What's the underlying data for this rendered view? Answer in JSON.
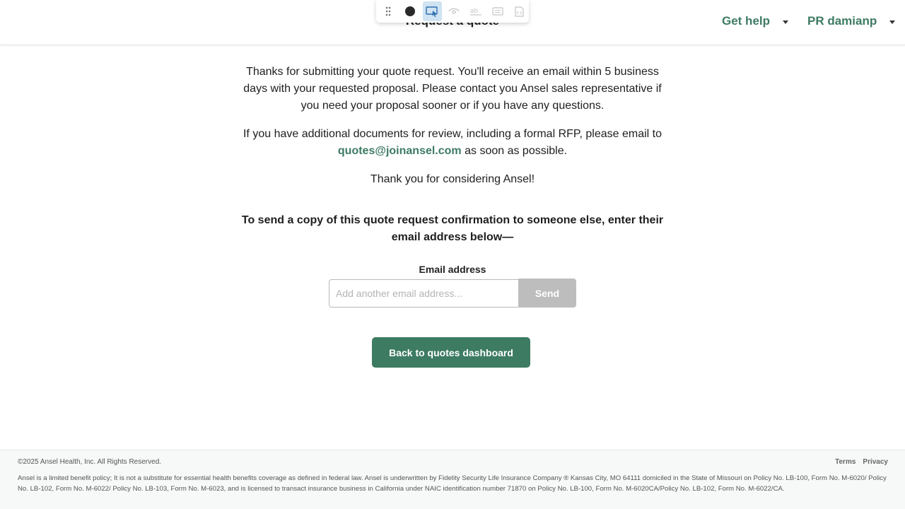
{
  "header": {
    "title": "Request a quote",
    "help_menu": "Get help",
    "user_menu": "PR damianp"
  },
  "toolbar": {
    "tools": [
      "drag-handle-icon",
      "record-icon",
      "select-element-icon",
      "eye-icon",
      "text-style-icon",
      "text-block-icon",
      "code-file-icon"
    ],
    "active_tool": "select-element-icon"
  },
  "confirmation": {
    "para1": "Thanks for submitting your quote request. You'll receive an email within 5 business days with your requested proposal. Please contact you Ansel sales representative if you need your proposal sooner or if you have any questions.",
    "para2_before": "If you have additional documents for review, including a formal RFP, please email to ",
    "email_link": "quotes@joinansel.com",
    "para2_after": " as soon as possible.",
    "para3": "Thank you for considering Ansel!"
  },
  "send_copy": {
    "heading": "To send a copy of this quote request confirmation to someone else, enter their email address below—",
    "label": "Email address",
    "placeholder": "Add another email address...",
    "value": "",
    "send_label": "Send"
  },
  "back_button": "Back to quotes dashboard",
  "footer": {
    "copyright": "©2025 Ansel Health, Inc. All Rights Reserved.",
    "links": [
      "Terms",
      "Privacy"
    ],
    "disclaimer": "Ansel is a limited benefit policy; It is not a substitute for essential health benefits coverage as defined in federal law. Ansel is underwritten by Fidelity Security Life Insurance Company ® Kansas City, MO 64111 domiciled in the State of Missouri on Policy No. LB-100, Form No. M-6020/ Policy No. LB-102, Form No. M-6022/ Policy No. LB-103, Form No. M-6023, and is licensed to transact insurance business in California under NAIC identification number 71870 on Policy No. LB-100, Form No. M-6020CA/Policy No. LB-102, Form No. M-6022/CA."
  },
  "colors": {
    "brand_green": "#3d7b63",
    "disabled_button": "#bdbdbd",
    "toolbar_active": "#cfe3f2"
  }
}
